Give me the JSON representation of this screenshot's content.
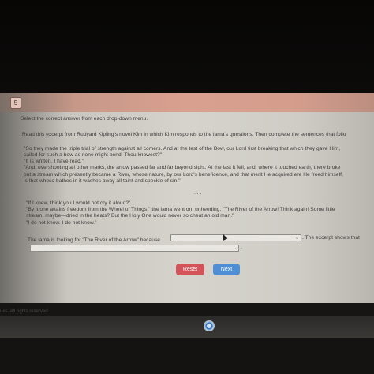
{
  "question": {
    "number": "5",
    "instruction": "Select the correct answer from each drop-down menu.",
    "prompt": "Read this excerpt from Rudyard Kipling's novel Kim in which Kim responds to the lama's questions. Then complete the sentences that follo",
    "excerpt": [
      "\"So they made the triple trial of strength against all comers. And at the test of the Bow, our Lord first breaking that which they gave Him,",
      "called for such a bow as none might bend. Thou knowest?\"",
      "\"It is written. I have read.\"",
      "\"And, overshooting all other marks, the arrow passed far and far beyond sight. At the last it fell; and, where it touched earth, there broke",
      "out a stream which presently became a River, whose nature, by our Lord's beneficence, and that merit He acquired ere He freed himself,",
      "is that whoso bathes in it washes away all taint and speckle of sin.\""
    ],
    "ellipsis": ". . .",
    "excerpt2": [
      "\"If I knew, think you I would not cry it aloud?\"",
      "\"By it one attains freedom from the Wheel of Things,\" the lama went on, unheeding. \"The River of the Arrow! Think again! Some little",
      "stream, maybe—dried in the heats? But the Holy One would never so cheat an old man.\"",
      "\"I do not know. I do not know.\""
    ],
    "sentence1": "The lama is looking for \"The River of the Arrow\" because",
    "sentence2": ". The excerpt shows that",
    "period": "."
  },
  "buttons": {
    "reset": "Reset",
    "next": "Next"
  },
  "footer": "ues. All rights reserved.",
  "colors": {
    "reset": "#d4535a",
    "next": "#4f8ed5",
    "header": "#d9a08f"
  },
  "icons": [
    "chevron-down-icon",
    "chrome-icon",
    "cursor-icon"
  ]
}
